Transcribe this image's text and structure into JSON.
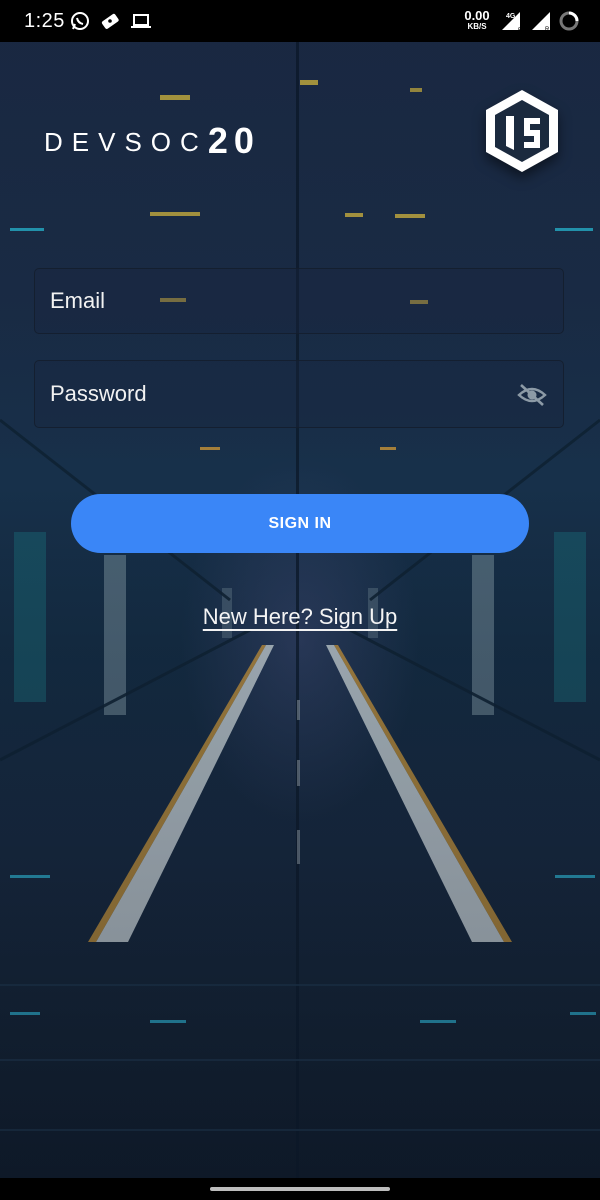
{
  "status_bar": {
    "time": "1:25",
    "net_speed_value": "0.00",
    "net_speed_unit": "KB/S",
    "icons": [
      "whatsapp-icon",
      "debug-ticket-icon",
      "laptop-icon",
      "4g-signal-icon",
      "wifi-signal-icon",
      "loading-circle-icon"
    ]
  },
  "header": {
    "app_title_word": "DEVSOC",
    "app_title_number": "20",
    "logo_icon": "hexagon-ds-logo-icon"
  },
  "form": {
    "email_placeholder": "Email",
    "email_value": "",
    "password_placeholder": "Password",
    "password_value": "",
    "password_toggle_icon": "eye-off-icon",
    "signin_label": "SIGN IN",
    "signup_link": "New Here? Sign Up"
  },
  "colors": {
    "primary_button": "#3a86f7",
    "text": "#ffffff",
    "status_bar": "#000000"
  }
}
